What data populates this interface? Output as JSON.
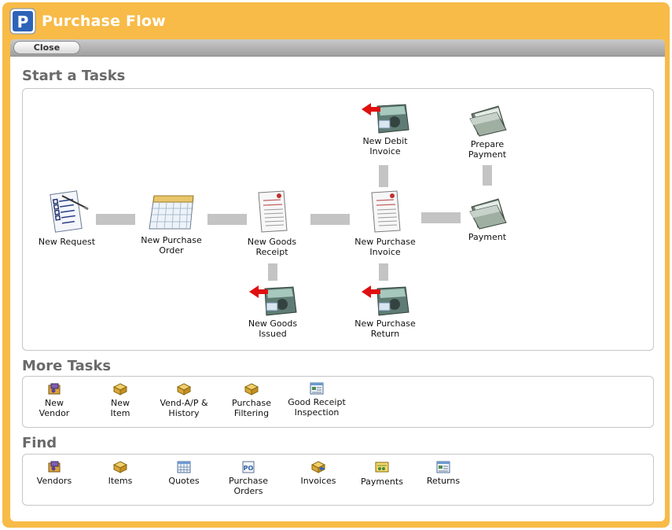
{
  "window": {
    "title": "Purchase Flow",
    "app_icon": "P"
  },
  "toolbar": {
    "close_label": "Close"
  },
  "start_tasks": {
    "heading": "Start a Tasks",
    "nodes": [
      {
        "id": "new-request",
        "label": "New Request",
        "icon": "checklist-icon"
      },
      {
        "id": "new-purchase-order",
        "label": "New Purchase\nOrder",
        "icon": "calendar-icon"
      },
      {
        "id": "new-goods-receipt",
        "label": "New Goods\nReceipt",
        "icon": "document-icon"
      },
      {
        "id": "new-purchase-invoice",
        "label": "New Purchase\nInvoice",
        "icon": "document-icon"
      },
      {
        "id": "payment",
        "label": "Payment",
        "icon": "folder-icon"
      },
      {
        "id": "new-debit-invoice",
        "label": "New Debit\nInvoice",
        "icon": "return-icon"
      },
      {
        "id": "prepare-payment",
        "label": "Prepare\nPayment",
        "icon": "folder-icon"
      },
      {
        "id": "new-goods-issued",
        "label": "New Goods\nIssued",
        "icon": "return-icon"
      },
      {
        "id": "new-purchase-return",
        "label": "New Purchase\nReturn",
        "icon": "return-icon"
      }
    ]
  },
  "more_tasks": {
    "heading": "More Tasks",
    "items": [
      {
        "label": "New\nVendor",
        "icon": "vendor-icon"
      },
      {
        "label": "New\nItem",
        "icon": "box-icon"
      },
      {
        "label": "Vend-A/P &\nHistory",
        "icon": "box-icon"
      },
      {
        "label": "Purchase\nFiltering",
        "icon": "box-icon"
      },
      {
        "label": "Good Receipt\nInspection",
        "icon": "inspection-icon"
      }
    ]
  },
  "find": {
    "heading": "Find",
    "items": [
      {
        "label": "Vendors",
        "icon": "vendor-icon"
      },
      {
        "label": "Items",
        "icon": "box-icon"
      },
      {
        "label": "Quotes",
        "icon": "grid-icon"
      },
      {
        "label": "Purchase\nOrders",
        "icon": "po-icon"
      },
      {
        "label": "Invoices",
        "icon": "invoice-icon"
      },
      {
        "label": "Payments",
        "icon": "payment-icon"
      },
      {
        "label": "Returns",
        "icon": "returns-icon"
      }
    ]
  },
  "colors": {
    "frame": "#f8bb48",
    "connector": "#c4c4c4",
    "heading": "#6a6a6a",
    "arrow": "#e01010"
  }
}
